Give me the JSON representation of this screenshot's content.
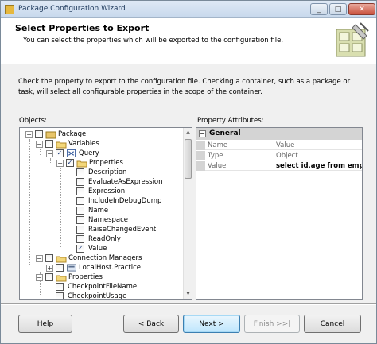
{
  "window": {
    "title": "Package Configuration Wizard",
    "minimize": "_",
    "maximize": "□",
    "close": "✕"
  },
  "header": {
    "title": "Select Properties to Export",
    "subtitle": "You can select the properties which will be exported to the configuration file."
  },
  "description": "Check the property to export to the configuration file. Checking a container, such as a package or task, will select all configurable properties in the scope of the container.",
  "objects_label": "Objects:",
  "attributes_label": "Property Attributes:",
  "tree": {
    "nodes": [
      {
        "label": "Package",
        "expander": "−",
        "check": ""
      },
      {
        "label": "Variables",
        "expander": "−",
        "check": ""
      },
      {
        "label": "Query",
        "expander": "−",
        "check": "✓"
      },
      {
        "label": "Properties",
        "expander": "−",
        "check": "✓"
      },
      {
        "label": "Description",
        "check": ""
      },
      {
        "label": "EvaluateAsExpression",
        "check": ""
      },
      {
        "label": "Expression",
        "check": ""
      },
      {
        "label": "IncludeInDebugDump",
        "check": ""
      },
      {
        "label": "Name",
        "check": ""
      },
      {
        "label": "Namespace",
        "check": ""
      },
      {
        "label": "RaiseChangedEvent",
        "check": ""
      },
      {
        "label": "ReadOnly",
        "check": ""
      },
      {
        "label": "Value",
        "check": "✓"
      },
      {
        "label": "Connection Managers",
        "expander": "−",
        "check": ""
      },
      {
        "label": "LocalHost.Practice",
        "expander": "+",
        "check": ""
      },
      {
        "label": "Properties",
        "expander": "−",
        "check": ""
      },
      {
        "label": "CheckpointFileName",
        "check": ""
      },
      {
        "label": "CheckpointUsage",
        "check": ""
      }
    ],
    "scroll_up": "▲",
    "scroll_down": "▼"
  },
  "properties": {
    "category": "General",
    "category_expander": "−",
    "rows": [
      {
        "name": "Name",
        "value": "Value",
        "bold": false
      },
      {
        "name": "Type",
        "value": "Object",
        "bold": false
      },
      {
        "name": "Value",
        "value": "select id,age from employ",
        "bold": true
      }
    ]
  },
  "buttons": {
    "help": "Help",
    "back": "< Back",
    "next": "Next >",
    "finish": "Finish >>|",
    "cancel": "Cancel"
  }
}
